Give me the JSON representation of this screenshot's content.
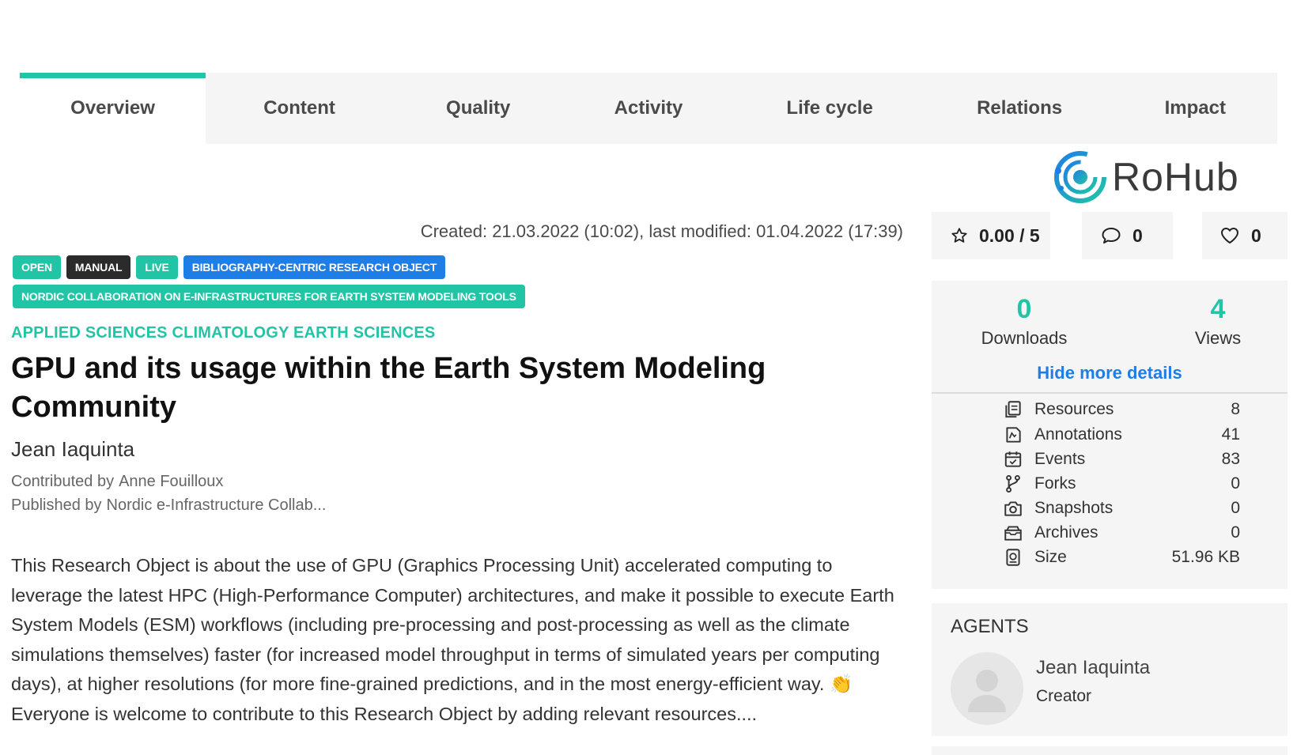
{
  "tabs": [
    "Overview",
    "Content",
    "Quality",
    "Activity",
    "Life cycle",
    "Relations",
    "Impact"
  ],
  "active_tab": "Overview",
  "logo_text": "RoHub",
  "dates": "Created: 21.03.2022 (10:02), last modified: 01.04.2022 (17:39)",
  "badges_row1": [
    "OPEN",
    "MANUAL",
    "LIVE",
    "BIBLIOGRAPHY-CENTRIC RESEARCH OBJECT"
  ],
  "badges_row2": [
    "NORDIC COLLABORATION ON E-INFRASTRUCTURES FOR EARTH SYSTEM MODELING TOOLS"
  ],
  "disciplines": "APPLIED SCIENCES CLIMATOLOGY EARTH SCIENCES",
  "title": "GPU and its usage within the Earth System Modeling Community",
  "author": "Jean Iaquinta",
  "contributed": {
    "label": "Contributed by",
    "value": "Anne Fouilloux"
  },
  "published": {
    "label": "Published by",
    "value": "Nordic e-Infrastructure Collab..."
  },
  "description": "This Research Object is about the use of GPU (Graphics Processing Unit) accelerated computing to leverage the latest HPC (High-Performance Computer) architectures, and make it possible to execute Earth System Models (ESM) workflows (including pre-processing and post-processing as well as the climate simulations themselves) faster (for increased model throughput in terms of simulated years per computing days), at higher resolutions (for more fine-grained predictions, and in the most energy-efficient way. 👏 Everyone is welcome to contribute to this Research Object by adding relevant resources....",
  "rating": "0.00 / 5",
  "comments": "0",
  "likes": "0",
  "downloads": {
    "value": "0",
    "label": "Downloads"
  },
  "views": {
    "value": "4",
    "label": "Views"
  },
  "hide_details": "Hide more details",
  "details": [
    {
      "icon": "resources-icon",
      "label": "Resources",
      "value": "8"
    },
    {
      "icon": "annotations-icon",
      "label": "Annotations",
      "value": "41"
    },
    {
      "icon": "events-icon",
      "label": "Events",
      "value": "83"
    },
    {
      "icon": "forks-icon",
      "label": "Forks",
      "value": "0"
    },
    {
      "icon": "snapshots-icon",
      "label": "Snapshots",
      "value": "0"
    },
    {
      "icon": "archives-icon",
      "label": "Archives",
      "value": "0"
    },
    {
      "icon": "size-icon",
      "label": "Size",
      "value": "51.96 KB"
    }
  ],
  "agents": {
    "title": "AGENTS",
    "name": "Jean Iaquinta",
    "role": "Creator"
  },
  "colors": {
    "accent": "#21c4a5",
    "blue": "#1f7ee6",
    "dark_badge": "#2b2b2b"
  }
}
